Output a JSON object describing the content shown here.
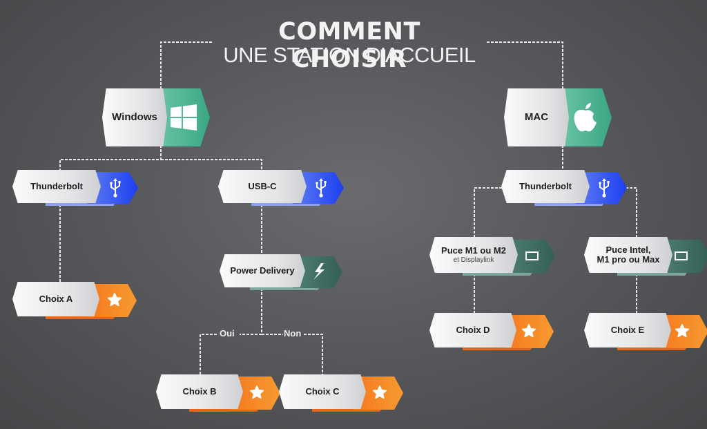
{
  "title": {
    "line1": "COMMENT CHOISIR",
    "line2": "UNE STATION D’ACCUEIL"
  },
  "colors": {
    "os_green": "#3fae8c",
    "usb_blue": "#2f55f0",
    "spec_teal": "#3e6f66",
    "choice_orange": "#f58220",
    "connector": "#e8e8e8"
  },
  "branches": {
    "windows": {
      "label": "Windows",
      "icon": "windows-logo-icon"
    },
    "mac": {
      "label": "MAC",
      "icon": "apple-logo-icon"
    }
  },
  "nodes": {
    "win_thunderbolt": {
      "label": "Thunderbolt",
      "icon": "usb-icon"
    },
    "win_usbc": {
      "label": "USB-C",
      "icon": "usb-icon"
    },
    "power_delivery": {
      "label": "Power Delivery",
      "icon": "lightning-icon"
    },
    "mac_thunderbolt": {
      "label": "Thunderbolt",
      "icon": "usb-icon"
    },
    "puce_m1_m2": {
      "label": "Puce M1 ou M2",
      "sublabel": "et Displaylink",
      "icon": "monitor-icon"
    },
    "puce_intel": {
      "label_line1": "Puce Intel,",
      "label_line2": "M1 pro ou Max",
      "icon": "monitor-icon"
    }
  },
  "choices": {
    "a": {
      "label": "Choix A",
      "icon": "star-icon"
    },
    "b": {
      "label": "Choix B",
      "icon": "star-icon"
    },
    "c": {
      "label": "Choix C",
      "icon": "star-icon"
    },
    "d": {
      "label": "Choix D",
      "icon": "star-icon"
    },
    "e": {
      "label": "Choix E",
      "icon": "star-icon"
    }
  },
  "edge_labels": {
    "yes": "Oui",
    "no": "Non"
  }
}
